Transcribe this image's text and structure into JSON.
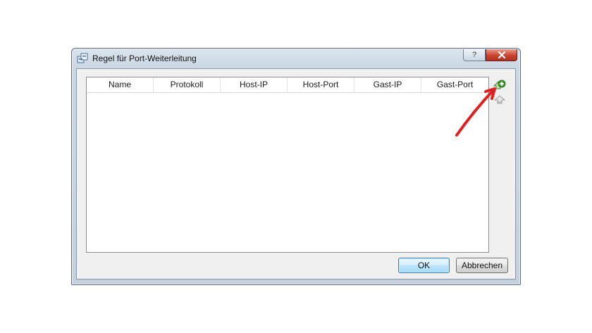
{
  "dialog": {
    "title": "Regel für Port-Weiterleitung",
    "help_label": "?",
    "icons": {
      "app": "network-ports-icon",
      "help": "question-icon",
      "close": "close-icon"
    }
  },
  "table": {
    "columns": [
      "Name",
      "Protokoll",
      "Host-IP",
      "Host-Port",
      "Gast-IP",
      "Gast-Port"
    ],
    "rows": []
  },
  "side_buttons": {
    "add_icon": "add-rule-icon",
    "remove_icon": "remove-rule-icon"
  },
  "buttons": {
    "ok": "OK",
    "cancel": "Abbrechen"
  },
  "annotation": {
    "arrow_color": "#e02020",
    "target": "add-rule-button"
  },
  "colors": {
    "ok_accent": "#3c7fb1",
    "close_red": "#c9432f",
    "add_green": "#3a9a2a"
  }
}
